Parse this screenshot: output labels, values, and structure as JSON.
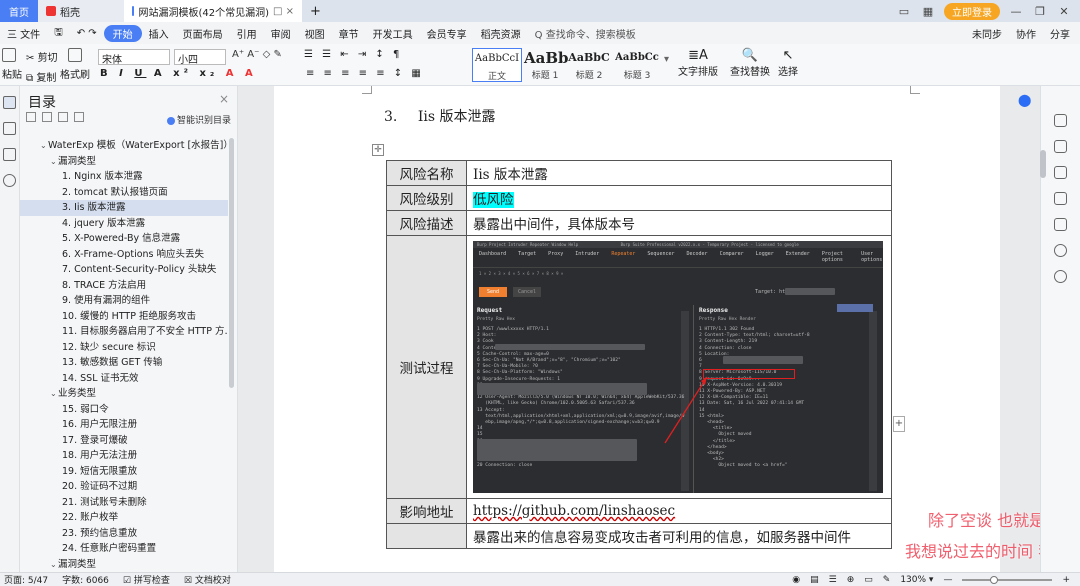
{
  "titlebar": {
    "home_tab": "首页",
    "tabs": [
      {
        "label": "稻壳",
        "icon": "docer-icon"
      },
      {
        "label": "网站漏洞模板(42个常见漏洞)",
        "icon": "doc-icon"
      }
    ],
    "new_tab": "+",
    "login_label": "立即登录"
  },
  "menubar": {
    "file_label": "三 文件",
    "items": [
      "开始",
      "插入",
      "页面布局",
      "引用",
      "审阅",
      "视图",
      "章节",
      "开发工具",
      "会员专享",
      "稻壳资源"
    ],
    "active_item": "开始",
    "search_label": "Q 查找命令、搜索模板",
    "right_items": [
      "未同步",
      "协作",
      "分享"
    ]
  },
  "ribbon": {
    "paste": "粘贴",
    "cut": "剪切",
    "copy": "复制",
    "format_painter": "格式刷",
    "font_name": "宋体",
    "font_size": "小四",
    "styles": [
      {
        "preview": "AaBbCcI",
        "label": "正文"
      },
      {
        "preview": "AaBb",
        "label": "标题 1"
      },
      {
        "preview": "AaBbC",
        "label": "标题 2"
      },
      {
        "preview": "AaBbCc",
        "label": "标题 3"
      }
    ],
    "text_layout": "文字排版",
    "find_replace": "查找替换",
    "select": "选择"
  },
  "toc": {
    "title": "目录",
    "smart_label": "智能识别目录",
    "items": [
      {
        "text": "WaterExp 模板（WaterExport [水报告]）",
        "level": 1,
        "caret": "⌄"
      },
      {
        "text": "漏洞类型",
        "level": 2,
        "caret": "⌄"
      },
      {
        "text": "1. Nginx 版本泄露",
        "level": 3
      },
      {
        "text": "2. tomcat 默认报错页面",
        "level": 3
      },
      {
        "text": "3. Iis 版本泄露",
        "level": 3,
        "selected": true
      },
      {
        "text": "4. jquery 版本泄露",
        "level": 3
      },
      {
        "text": "5. X-Powered-By 信息泄露",
        "level": 3
      },
      {
        "text": "6. X-Frame-Options 响应头丢失",
        "level": 3
      },
      {
        "text": "7. Content-Security-Policy 头缺失",
        "level": 3
      },
      {
        "text": "8. TRACE 方法启用",
        "level": 3
      },
      {
        "text": "9. 使用有漏洞的组件",
        "level": 3
      },
      {
        "text": "10. 缓慢的 HTTP 拒绝服务攻击",
        "level": 3
      },
      {
        "text": "11. 目标服务器启用了不安全 HTTP 方…",
        "level": 3
      },
      {
        "text": "12. 缺少 secure 标识",
        "level": 3
      },
      {
        "text": "13. 敏感数据 GET 传输",
        "level": 3
      },
      {
        "text": "14. SSL 证书无效",
        "level": 3
      },
      {
        "text": "业务类型",
        "level": 2,
        "caret": "⌄"
      },
      {
        "text": "15. 弱口令",
        "level": 3
      },
      {
        "text": "16. 用户无限注册",
        "level": 3
      },
      {
        "text": "17. 登录可爆破",
        "level": 3
      },
      {
        "text": "18. 用户无法注册",
        "level": 3
      },
      {
        "text": "19. 短信无限重放",
        "level": 3
      },
      {
        "text": "20. 验证码不过期",
        "level": 3
      },
      {
        "text": "21. 测试账号未删除",
        "level": 3
      },
      {
        "text": "22. 账户枚举",
        "level": 3
      },
      {
        "text": "23. 预约信息重放",
        "level": 3
      },
      {
        "text": "24. 任意账户密码重置",
        "level": 3
      },
      {
        "text": "漏洞类型",
        "level": 2,
        "caret": "⌄"
      }
    ]
  },
  "document": {
    "heading_num": "3.",
    "heading_text": "Iis 版本泄露",
    "rows": [
      {
        "key": "风险名称",
        "value": "Iis 版本泄露"
      },
      {
        "key": "风险级别",
        "value": "低风险"
      },
      {
        "key": "风险描述",
        "value": "暴露出中间件，具体版本号"
      },
      {
        "key": "测试过程",
        "value": ""
      },
      {
        "key": "影响地址",
        "value": "https://github.com/linshaosec"
      },
      {
        "key": "",
        "value": "暴露出来的信息容易变成攻击者可利用的信息，如服务器中间件"
      }
    ]
  },
  "burp": {
    "menu": "Burp  Project  Intruder  Repeater  Window  Help",
    "title": "Burp Suite Professional v2022.x.x - Temporary Project - licensed to google",
    "tabs": [
      "Dashboard",
      "Target",
      "Proxy",
      "Intruder",
      "Repeater",
      "Sequencer",
      "Decoder",
      "Comparer",
      "Logger",
      "Extender",
      "Project options",
      "User options"
    ],
    "active_tab": "Repeater",
    "send": "Send",
    "cancel": "Cancel",
    "target": "Target: https://",
    "request_title": "Request",
    "response_title": "Response",
    "req_subtabs": "Pretty   Raw   Hex",
    "resp_subtabs": "Pretty   Raw   Hex   Render",
    "request_lines": "1 POST /wwwlxxxxx HTTP/1.1\n2 Host:\n3 Cook\n4 Content-Length: 15\n5 Cache-Control: max-age=0\n6 Sec-Ch-Ua: \"Not A/Brand\";v=\"8\", \"Chromium\";v=\"102\"\n7 Sec-Ch-Ua-Mobile: ?0\n8 Sec-Ch-Ua-Platform: \"Windows\"\n9 Upgrade-Insecure-Requests: 1\n10\n11 Content-Type: application/x-www-form-urlencoded\n12 User-Agent: Mozilla/5.0 (Windows NT 10.0; Win64; x64) AppleWebKit/537.36\n   (KHTML, like Gecko) Chrome/102.0.5005.63 Safari/537.36\n13 Accept:\n   text/html,application/xhtml+xml,application/xml;q=0.9,image/avif,image/w\n   ebp,image/apng,*/*;q=0.8,application/signed-exchange;v=b3;q=0.9\n14\n15\n16\n17\n18 Accept-Encoding: gzip, deflate\n19 Accept-Language: zh-CN,zh;q=0.9\n20 Connection: close",
    "response_lines": "1 HTTP/1.1 302 Found\n2 Content-Type: text/html; charset=utf-8\n3 Content-Length: 219\n4 Connection: close\n5 Location:\n6\n7\n8 Server: Microsoft-IIS/10.0\n9 request-id: 0c9e9...\n10 X-AspNet-Version: 4.0.30319\n11 X-Powered-By: ASP.NET\n12 X-UA-Compatible: IE=11\n13 Date: Sat, 16 Jul 2022 07:41:14 GMT\n14\n15 <html>\n   <head>\n     <title>\n       Object moved\n     </title>\n   </head>\n   <body>\n     <h2>\n       Object moved to <a href=\""
  },
  "watermark": {
    "line1": "除了空谈 也就是看",
    "line2": "我想说过去的时间 我"
  },
  "status": {
    "page": "页面: 5/47",
    "words": "字数: 6066",
    "spellcheck": "拼写检查",
    "proofread": "文档校对",
    "zoom": "130%"
  },
  "colors": {
    "accent": "#4a7ef5",
    "highlight": "#00ffff",
    "login": "#f6a623",
    "watermark": "#ee4455",
    "burp_orange": "#f08030",
    "annotation_red": "#e02020"
  }
}
